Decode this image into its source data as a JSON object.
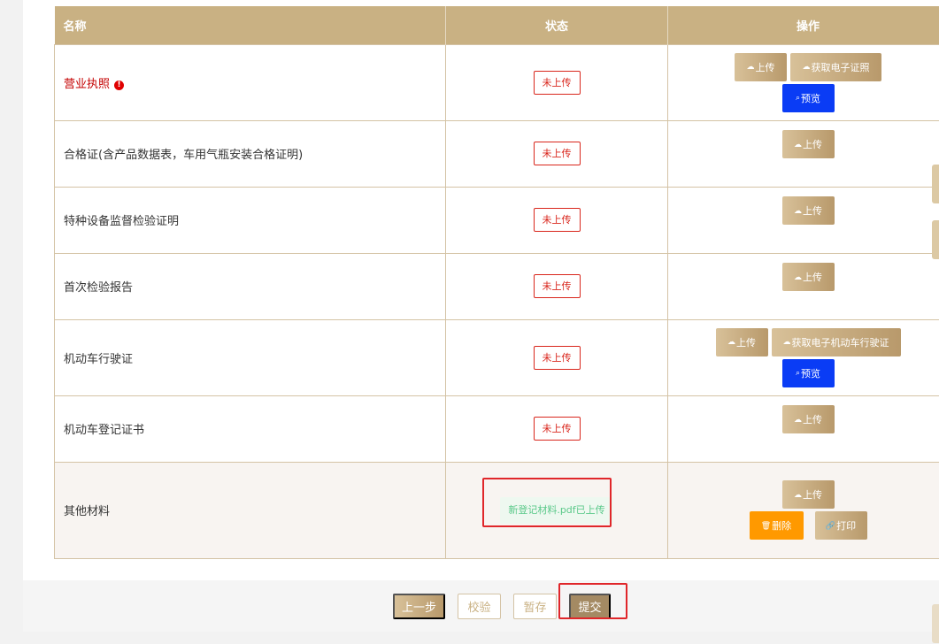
{
  "table": {
    "headers": {
      "name": "名称",
      "status": "状态",
      "ops": "操作"
    },
    "rows": [
      {
        "name": "营业执照",
        "status": "未上传"
      },
      {
        "name": "合格证(含产品数据表，车用气瓶安装合格证明)",
        "status": "未上传"
      },
      {
        "name": "特种设备监督检验证明",
        "status": "未上传"
      },
      {
        "name": "首次检验报告",
        "status": "未上传"
      },
      {
        "name": "机动车行驶证",
        "status": "未上传"
      },
      {
        "name": "机动车登记证书",
        "status": "未上传"
      },
      {
        "name": "其他材料",
        "status": "新登记材料.pdf已上传"
      }
    ]
  },
  "buttons": {
    "upload": "上传",
    "get_e_license": "获取电子证照",
    "get_e_vehicle_license": "获取电子机动车行驶证",
    "preview": "预览",
    "delete": "删除",
    "print": "打印"
  },
  "footer": {
    "prev": "上一步",
    "verify": "校验",
    "save": "暂存",
    "submit": "提交"
  },
  "colors": {
    "header": "#c9b183",
    "accent_blue": "#0a3cf5",
    "accent_orange": "#ff9900",
    "error": "#d9261c",
    "success": "#5bc98a"
  },
  "icons": {
    "upload": "cloud-upload-icon",
    "preview": "search-icon",
    "delete": "trash-icon",
    "print": "link-icon",
    "required": "exclamation-circle-icon"
  }
}
